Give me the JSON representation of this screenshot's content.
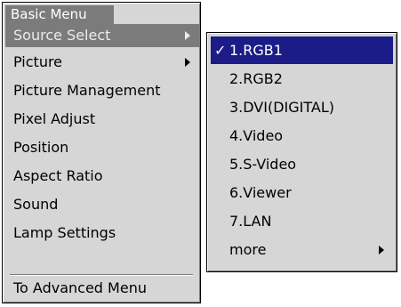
{
  "menu": {
    "title": "Basic Menu",
    "items": [
      {
        "label": "Source Select",
        "has_submenu": true
      },
      {
        "label": "Picture",
        "has_submenu": true
      },
      {
        "label": "Picture Management"
      },
      {
        "label": "Pixel Adjust"
      },
      {
        "label": "Position"
      },
      {
        "label": "Aspect Ratio"
      },
      {
        "label": "Sound"
      },
      {
        "label": "Lamp Settings"
      },
      {
        "label": "To Advanced Menu"
      }
    ]
  },
  "submenu": {
    "check_mark": "✓",
    "items": [
      {
        "label": "1.RGB1",
        "checked": true
      },
      {
        "label": "2.RGB2"
      },
      {
        "label": "3.DVI(DIGITAL)"
      },
      {
        "label": "4.Video"
      },
      {
        "label": "5.S-Video"
      },
      {
        "label": "6.Viewer"
      },
      {
        "label": "7.LAN"
      },
      {
        "label": "more",
        "has_submenu": true
      }
    ]
  },
  "colors": {
    "menu_bg": "#d6d6d6",
    "selected_bg": "#7b7b7b",
    "highlight_bg": "#1c1c88"
  }
}
